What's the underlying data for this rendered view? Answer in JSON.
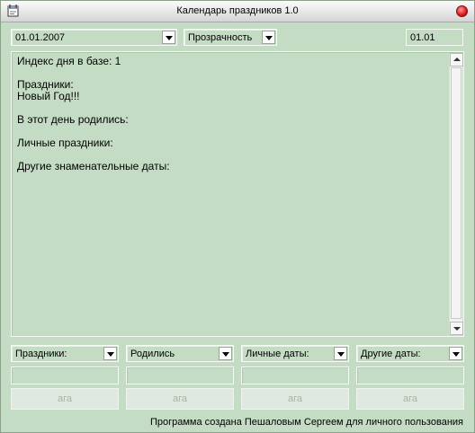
{
  "window": {
    "title": "Календарь праздников 1.0"
  },
  "controls": {
    "date_value": "01.01.2007",
    "transparency_value": "Прозрачность",
    "date_code": "01.01"
  },
  "info": {
    "text": "Индекс дня в базе: 1\n\nПраздники:\nНовый Год!!!\n\nВ этот день родились:\n\nЛичные праздники:\n\nДругие знаменательные даты:"
  },
  "categories": [
    {
      "label": "Праздники:",
      "button_label": "ага"
    },
    {
      "label": "Родились",
      "button_label": "ага"
    },
    {
      "label": "Личные даты:",
      "button_label": "ага"
    },
    {
      "label": "Другие даты:",
      "button_label": "ага"
    }
  ],
  "footer": {
    "text": "Программа создана Пешаловым Сергеем для личного пользования"
  },
  "icons": {
    "app": "calendar-app-icon",
    "close": "close-icon",
    "dropdown": "chevron-down-icon",
    "scroll_up": "scroll-up-icon",
    "scroll_down": "scroll-down-icon"
  }
}
